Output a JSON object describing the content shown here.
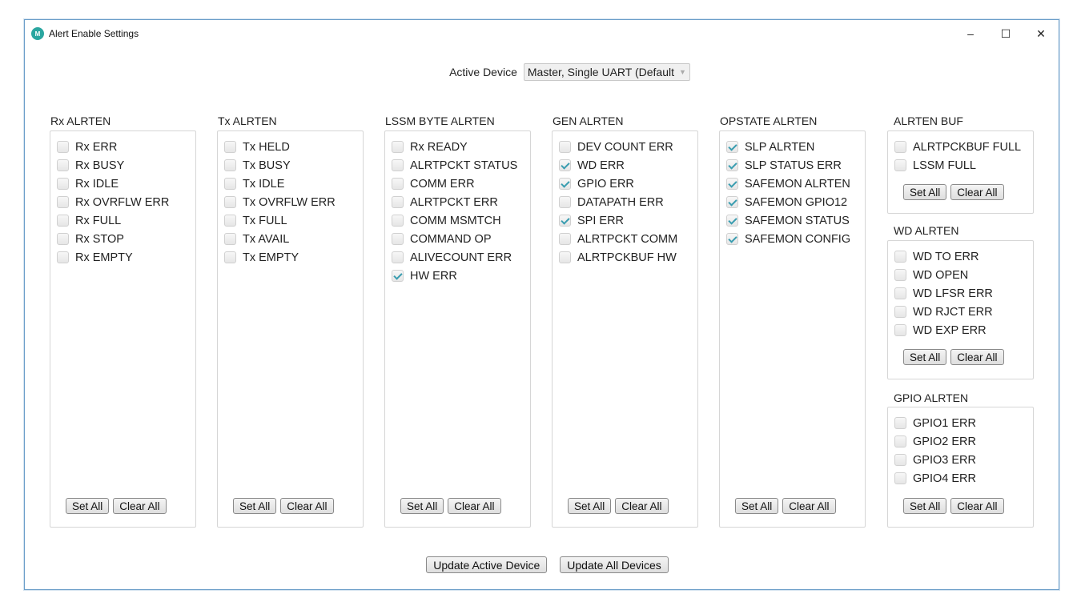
{
  "window": {
    "title": "Alert Enable Settings",
    "icon_text": "M",
    "controls": {
      "minimize": "–",
      "maximize": "☐",
      "close": "✕"
    }
  },
  "active_device": {
    "label": "Active Device",
    "value": "Master, Single UART (Default"
  },
  "groups": [
    {
      "id": "rx",
      "title": "Rx ALRTEN",
      "items": [
        {
          "label": "Rx ERR",
          "checked": false
        },
        {
          "label": "Rx BUSY",
          "checked": false
        },
        {
          "label": "Rx IDLE",
          "checked": false
        },
        {
          "label": "Rx OVRFLW ERR",
          "checked": false
        },
        {
          "label": "Rx FULL",
          "checked": false
        },
        {
          "label": "Rx STOP",
          "checked": false
        },
        {
          "label": "Rx EMPTY",
          "checked": false
        }
      ]
    },
    {
      "id": "tx",
      "title": "Tx ALRTEN",
      "items": [
        {
          "label": "Tx HELD",
          "checked": false
        },
        {
          "label": "Tx BUSY",
          "checked": false
        },
        {
          "label": "Tx IDLE",
          "checked": false
        },
        {
          "label": "Tx OVRFLW ERR",
          "checked": false
        },
        {
          "label": "Tx FULL",
          "checked": false
        },
        {
          "label": "Tx AVAIL",
          "checked": false
        },
        {
          "label": "Tx EMPTY",
          "checked": false
        }
      ]
    },
    {
      "id": "lssm",
      "title": "LSSM BYTE ALRTEN",
      "items": [
        {
          "label": "Rx READY",
          "checked": false
        },
        {
          "label": "ALRTPCKT STATUS",
          "checked": false
        },
        {
          "label": "COMM ERR",
          "checked": false
        },
        {
          "label": "ALRTPCKT ERR",
          "checked": false
        },
        {
          "label": "COMM MSMTCH",
          "checked": false
        },
        {
          "label": "COMMAND OP",
          "checked": false
        },
        {
          "label": "ALIVECOUNT ERR",
          "checked": false
        },
        {
          "label": "HW ERR",
          "checked": true
        }
      ]
    },
    {
      "id": "gen",
      "title": "GEN ALRTEN",
      "items": [
        {
          "label": "DEV COUNT ERR",
          "checked": false
        },
        {
          "label": "WD ERR",
          "checked": true
        },
        {
          "label": "GPIO ERR",
          "checked": true
        },
        {
          "label": "DATAPATH ERR",
          "checked": false
        },
        {
          "label": "SPI ERR",
          "checked": true
        },
        {
          "label": "ALRTPCKT COMM",
          "checked": false
        },
        {
          "label": "ALRTPCKBUF HW",
          "checked": false
        }
      ]
    },
    {
      "id": "opstate",
      "title": "OPSTATE ALRTEN",
      "items": [
        {
          "label": "SLP ALRTEN",
          "checked": true
        },
        {
          "label": "SLP STATUS ERR",
          "checked": true
        },
        {
          "label": "SAFEMON ALRTEN",
          "checked": true
        },
        {
          "label": "SAFEMON GPIO12",
          "checked": true
        },
        {
          "label": "SAFEMON STATUS",
          "checked": true
        },
        {
          "label": "SAFEMON CONFIG",
          "checked": true
        }
      ]
    },
    {
      "id": "alrtenbuf",
      "title": "ALRTEN BUF",
      "items": [
        {
          "label": "ALRTPCKBUF FULL",
          "checked": false
        },
        {
          "label": "LSSM FULL",
          "checked": false
        }
      ]
    },
    {
      "id": "wd",
      "title": "WD ALRTEN",
      "items": [
        {
          "label": "WD TO ERR",
          "checked": false
        },
        {
          "label": "WD OPEN",
          "checked": false
        },
        {
          "label": "WD LFSR ERR",
          "checked": false
        },
        {
          "label": "WD RJCT ERR",
          "checked": false
        },
        {
          "label": "WD EXP ERR",
          "checked": false
        }
      ]
    },
    {
      "id": "gpio",
      "title": "GPIO ALRTEN",
      "items": [
        {
          "label": "GPIO1 ERR",
          "checked": false
        },
        {
          "label": "GPIO2 ERR",
          "checked": false
        },
        {
          "label": "GPIO3 ERR",
          "checked": false
        },
        {
          "label": "GPIO4 ERR",
          "checked": false
        }
      ]
    }
  ],
  "buttons": {
    "set_all": "Set All",
    "clear_all": "Clear All",
    "update_active": "Update Active Device",
    "update_all": "Update All Devices"
  },
  "colors": {
    "check_accent": "#3a9db0",
    "window_border": "#6b9ec9",
    "app_icon": "#2aa6a0"
  }
}
